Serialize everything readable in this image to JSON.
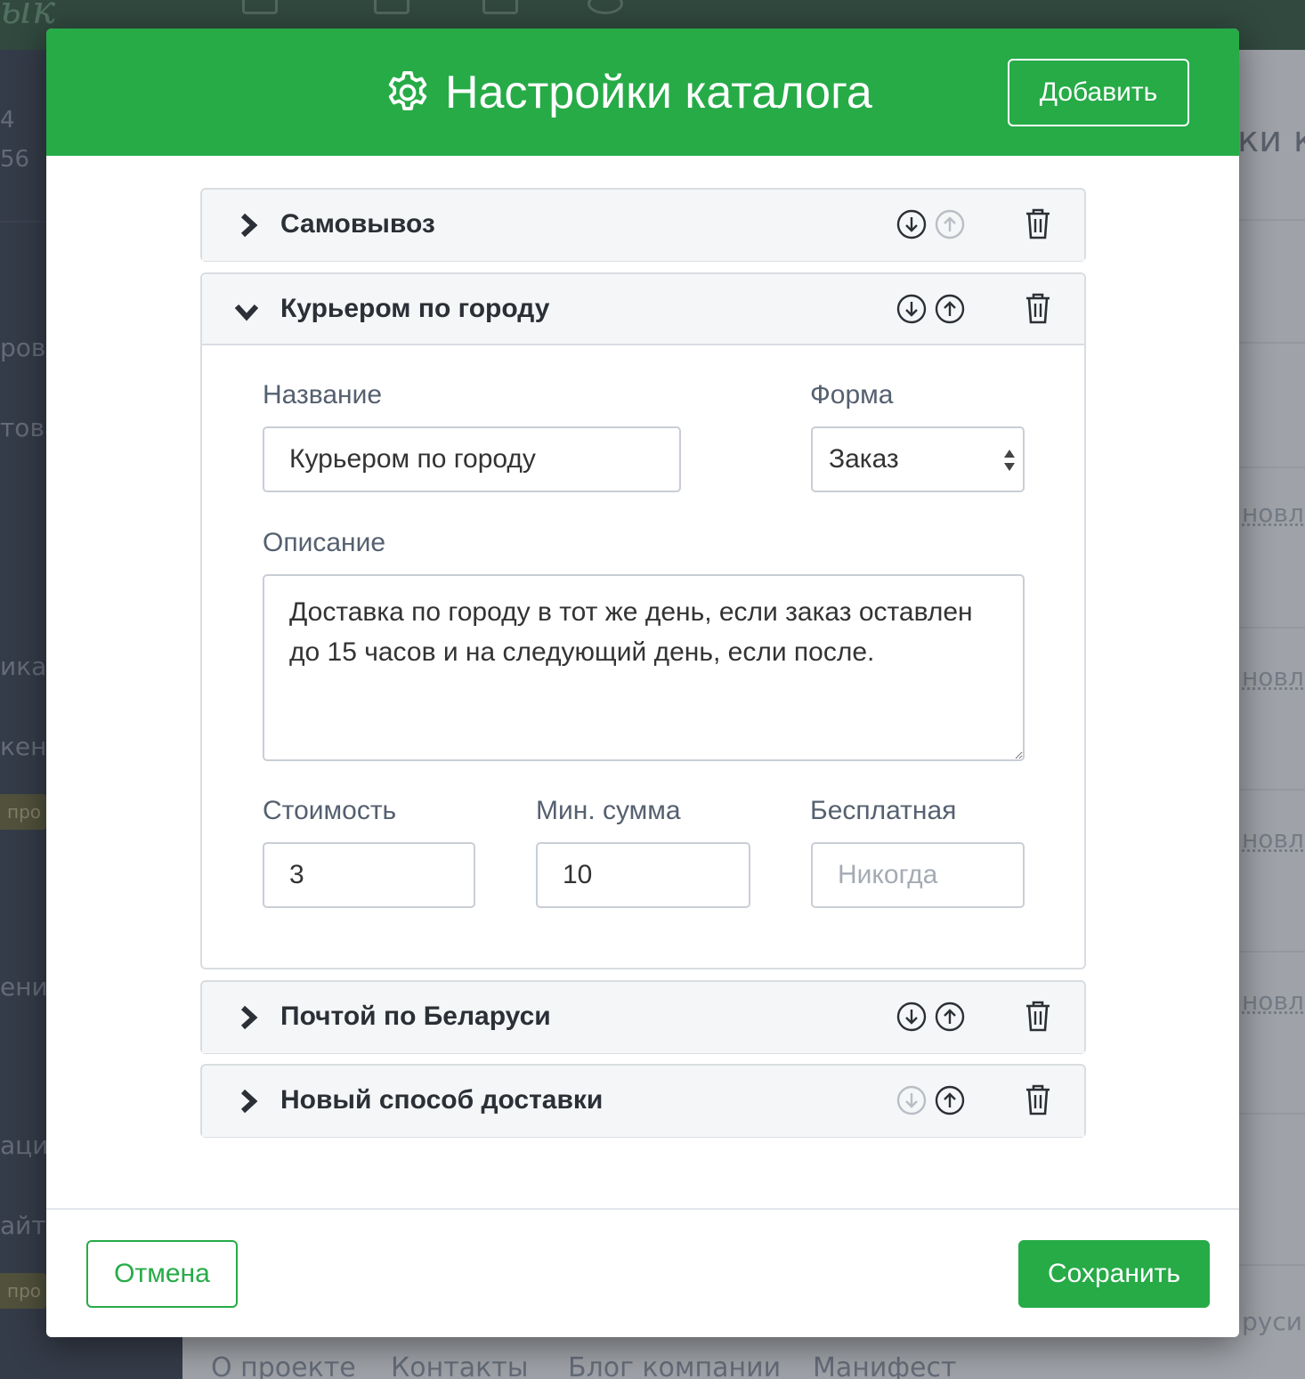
{
  "background": {
    "logo_text": "ык",
    "sidebar_numbers": [
      "4",
      "56"
    ],
    "sidebar_items": [
      "ров",
      "това",
      "ика",
      "кен",
      "ени",
      "аци",
      "айт"
    ],
    "badge": "про",
    "content_title": "ки ка",
    "row_link": "новле",
    "row_link_last": "руси",
    "footer_links": [
      "О проекте",
      "Контакты",
      "Блог компании",
      "Манифест"
    ]
  },
  "modal": {
    "title": "Настройки каталога",
    "title_icon": "gear-icon",
    "add_label": "Добавить",
    "cancel_label": "Отмена",
    "save_label": "Сохранить",
    "accent_color": "#26ab47"
  },
  "sections": [
    {
      "label": "Самовывоз",
      "expanded": false,
      "down_enabled": true,
      "up_enabled": false
    },
    {
      "label": "Курьером по городу",
      "expanded": true,
      "down_enabled": true,
      "up_enabled": true
    },
    {
      "label": "Почтой по Беларуси",
      "expanded": false,
      "down_enabled": true,
      "up_enabled": true
    },
    {
      "label": "Новый способ доставки",
      "expanded": false,
      "down_enabled": false,
      "up_enabled": true
    }
  ],
  "form": {
    "name_label": "Название",
    "name_value": "Курьером по городу",
    "form_label": "Форма",
    "form_value": "Заказ",
    "description_label": "Описание",
    "description_value": "Доставка по городу в тот же день, если заказ оставлен до 15 часов и на следующий день, если после.",
    "cost_label": "Стоимость",
    "cost_value": "3",
    "min_sum_label": "Мин. сумма",
    "min_sum_value": "10",
    "free_label": "Бесплатная",
    "free_placeholder": "Никогда"
  }
}
